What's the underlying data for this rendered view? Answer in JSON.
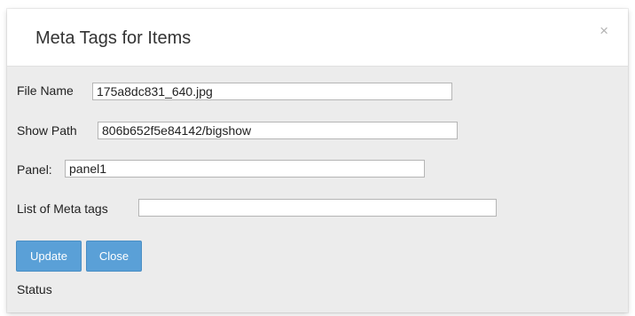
{
  "modal": {
    "title": "Meta Tags for Items",
    "close_glyph": "×"
  },
  "fields": {
    "file_name": {
      "label": "File Name",
      "value": "175a8dc831_640.jpg"
    },
    "show_path": {
      "label": "Show Path",
      "value": "806b652f5e84142/bigshow"
    },
    "panel": {
      "label": "Panel:",
      "value": "panel1"
    },
    "meta_tags": {
      "label": "List of Meta tags",
      "value": ""
    }
  },
  "buttons": {
    "update": "Update",
    "close": "Close"
  },
  "status": {
    "label": "Status"
  },
  "colors": {
    "button_bg": "#5aa0d7",
    "modal_body": "#ececec"
  }
}
